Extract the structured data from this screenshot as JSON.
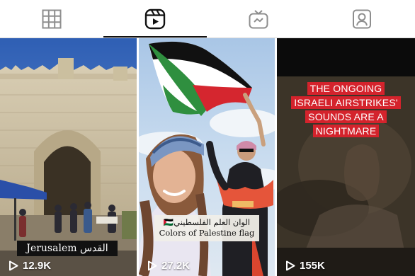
{
  "tabs": [
    {
      "name": "tab-grid",
      "icon": "grid-icon",
      "active": false
    },
    {
      "name": "tab-reels",
      "icon": "reels-icon",
      "active": true
    },
    {
      "name": "tab-igtv",
      "icon": "igtv-icon",
      "active": false
    },
    {
      "name": "tab-tagged",
      "icon": "tagged-user-icon",
      "active": false
    }
  ],
  "reels": [
    {
      "caption": "Jerusalem القدس",
      "views": "12.9K"
    },
    {
      "caption_line1": "🇵🇸الوان العلم الفلسطيني",
      "caption_line2": "Colors of Palestine flag",
      "views": "27.2K"
    },
    {
      "headline": [
        "THE ONGOING",
        "ISRAELI AIRSTRIKES'",
        "SOUNDS ARE A",
        "NIGHTMARE"
      ],
      "views": "155K"
    }
  ],
  "colors": {
    "accent": "#111111",
    "headline_red": "#d4232c",
    "flag_green": "#2f8f3f",
    "flag_red": "#d5262f"
  }
}
